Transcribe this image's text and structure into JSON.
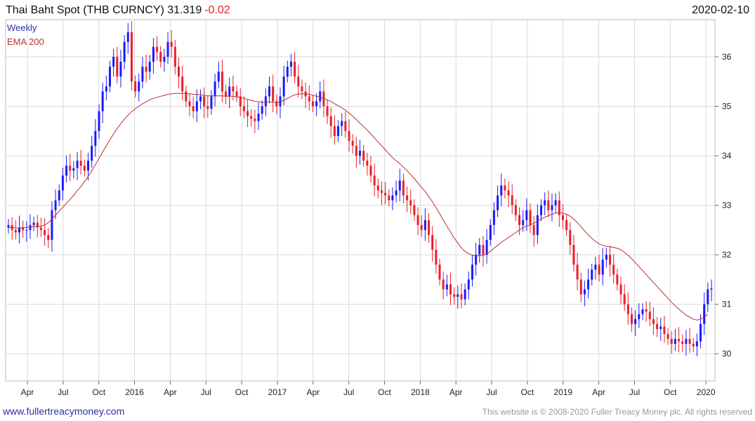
{
  "header": {
    "title": "Thai Baht Spot (THB CURNCY) 31.319",
    "change": "-0.02",
    "date": "2020-02-10"
  },
  "legend": {
    "weekly": "Weekly",
    "ema": "EMA 200"
  },
  "footer": {
    "site": "www.fullertreacymoney.com",
    "copyright": "This website is © 2008-2020 Fuller Treacy Money plc. All rights reserved"
  },
  "colors": {
    "up": "#1a1aff",
    "down": "#e8202a",
    "ema": "#b83232",
    "grid": "#d9d9d9"
  },
  "chart_data": {
    "type": "line",
    "yticks": [
      30,
      31,
      32,
      33,
      34,
      35,
      36
    ],
    "ylim": [
      29.45,
      36.75
    ],
    "xticks": [
      "Apr",
      "Jul",
      "Oct",
      "2016",
      "Apr",
      "Jul",
      "Oct",
      "2017",
      "Apr",
      "Jul",
      "Oct",
      "2018",
      "Apr",
      "Jul",
      "Oct",
      "2019",
      "Apr",
      "Jul",
      "Oct",
      "2020"
    ],
    "grid": true,
    "series": [
      {
        "name": "Weekly",
        "style": "candlestick",
        "close": [
          32.6,
          32.5,
          32.45,
          32.55,
          32.5,
          32.5,
          32.6,
          32.65,
          32.55,
          32.5,
          32.4,
          32.3,
          32.9,
          33.1,
          33.3,
          33.6,
          33.8,
          33.7,
          33.75,
          33.9,
          33.8,
          33.7,
          33.9,
          34.2,
          34.5,
          34.9,
          35.3,
          35.4,
          35.8,
          36.0,
          35.6,
          35.9,
          36.3,
          36.5,
          35.5,
          35.3,
          35.5,
          35.8,
          35.7,
          35.9,
          36.2,
          36.1,
          35.9,
          36.0,
          36.3,
          36.2,
          35.8,
          35.6,
          35.3,
          35.1,
          35.0,
          34.9,
          35.1,
          35.2,
          35.0,
          34.95,
          35.2,
          35.5,
          35.7,
          35.3,
          35.2,
          35.4,
          35.3,
          35.2,
          35.0,
          34.9,
          34.8,
          34.75,
          34.7,
          34.85,
          35.0,
          35.2,
          35.4,
          35.1,
          35.0,
          35.2,
          35.6,
          35.8,
          35.9,
          35.6,
          35.4,
          35.3,
          35.2,
          35.1,
          35.0,
          35.1,
          35.3,
          35.0,
          34.8,
          34.6,
          34.4,
          34.6,
          34.7,
          34.5,
          34.3,
          34.2,
          34.0,
          34.1,
          33.9,
          33.8,
          33.6,
          33.4,
          33.3,
          33.25,
          33.2,
          33.1,
          33.2,
          33.3,
          33.5,
          33.2,
          33.1,
          33.0,
          32.8,
          32.6,
          32.5,
          32.7,
          32.4,
          32.1,
          31.8,
          31.5,
          31.3,
          31.4,
          31.2,
          31.15,
          31.2,
          31.1,
          31.3,
          31.5,
          31.8,
          32.0,
          32.2,
          32.0,
          32.3,
          32.6,
          32.9,
          33.2,
          33.4,
          33.3,
          33.2,
          33.0,
          32.8,
          32.6,
          32.7,
          32.9,
          32.6,
          32.4,
          32.8,
          33.0,
          33.1,
          32.9,
          33.0,
          33.1,
          32.8,
          32.7,
          32.5,
          32.2,
          31.8,
          31.5,
          31.2,
          31.3,
          31.5,
          31.7,
          31.8,
          31.6,
          31.9,
          32.0,
          31.8,
          31.6,
          31.4,
          31.2,
          31.0,
          30.8,
          30.6,
          30.7,
          30.8,
          30.9,
          30.85,
          30.7,
          30.6,
          30.5,
          30.55,
          30.4,
          30.3,
          30.2,
          30.3,
          30.25,
          30.2,
          30.3,
          30.2,
          30.15,
          30.25,
          30.6,
          31.0,
          31.3,
          31.32
        ],
        "ema": [
          32.55,
          32.55,
          32.54,
          32.54,
          32.55,
          32.55,
          32.56,
          32.57,
          32.57,
          32.58,
          32.6,
          32.65,
          32.72,
          32.8,
          32.88,
          32.96,
          33.04,
          33.12,
          33.2,
          33.3,
          33.38,
          33.48,
          33.58,
          33.7,
          33.82,
          33.95,
          34.08,
          34.2,
          34.32,
          34.44,
          34.55,
          34.65,
          34.74,
          34.82,
          34.89,
          34.95,
          35.0,
          35.05,
          35.09,
          35.13,
          35.16,
          35.18,
          35.2,
          35.22,
          35.24,
          35.25,
          35.26,
          35.26,
          35.26,
          35.26,
          35.25,
          35.24,
          35.24,
          35.23,
          35.22,
          35.21,
          35.21,
          35.21,
          35.21,
          35.21,
          35.2,
          35.2,
          35.2,
          35.19,
          35.18,
          35.16,
          35.14,
          35.12,
          35.1,
          35.09,
          35.08,
          35.08,
          35.09,
          35.08,
          35.08,
          35.09,
          35.12,
          35.16,
          35.2,
          35.23,
          35.25,
          35.25,
          35.25,
          35.24,
          35.22,
          35.2,
          35.19,
          35.16,
          35.13,
          35.1,
          35.05,
          35.01,
          34.97,
          34.92,
          34.86,
          34.8,
          34.73,
          34.66,
          34.59,
          34.52,
          34.44,
          34.36,
          34.28,
          34.2,
          34.12,
          34.04,
          33.96,
          33.9,
          33.84,
          33.77,
          33.7,
          33.62,
          33.54,
          33.45,
          33.36,
          33.28,
          33.18,
          33.07,
          32.95,
          32.83,
          32.7,
          32.58,
          32.46,
          32.34,
          32.24,
          32.14,
          32.07,
          32.02,
          31.99,
          31.98,
          31.98,
          31.99,
          32.02,
          32.07,
          32.13,
          32.19,
          32.25,
          32.3,
          32.35,
          32.4,
          32.45,
          32.5,
          32.55,
          32.58,
          32.6,
          32.64,
          32.68,
          32.72,
          32.76,
          32.79,
          32.82,
          32.84,
          32.85,
          32.84,
          32.82,
          32.78,
          32.72,
          32.65,
          32.57,
          32.48,
          32.4,
          32.33,
          32.27,
          32.22,
          32.19,
          32.17,
          32.16,
          32.15,
          32.13,
          32.1,
          32.05,
          31.99,
          31.92,
          31.84,
          31.76,
          31.68,
          31.6,
          31.52,
          31.44,
          31.36,
          31.28,
          31.2,
          31.12,
          31.04,
          30.97,
          30.9,
          30.84,
          30.78,
          30.74,
          30.7,
          30.68,
          30.7,
          30.74,
          30.8
        ]
      }
    ]
  }
}
